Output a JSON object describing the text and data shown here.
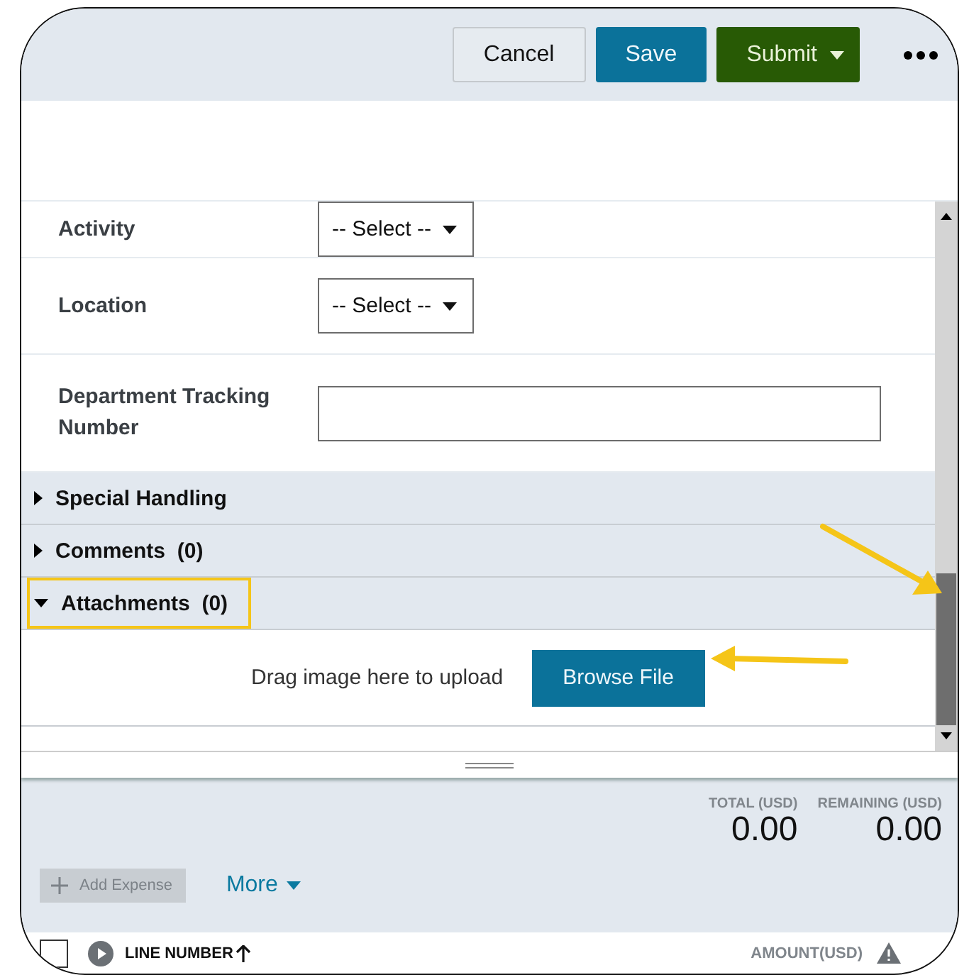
{
  "toolbar": {
    "buttons": [
      {
        "label": "Cancel",
        "kind": "secondary"
      },
      {
        "label": "Save",
        "kind": "primary"
      },
      {
        "label": "Submit",
        "kind": "submit"
      }
    ]
  },
  "form": {
    "fields": [
      {
        "label": "Activity",
        "kind": "select",
        "value": "-- Select --"
      },
      {
        "label": "Location",
        "kind": "select",
        "value": "-- Select --"
      },
      {
        "label": "Department Tracking Number",
        "kind": "text"
      }
    ]
  },
  "sections": [
    {
      "title": "Special Handling",
      "expanded": false,
      "highlighted": false
    },
    {
      "title": "Comments",
      "count": "(0)",
      "expanded": false,
      "highlighted": false
    },
    {
      "title": "Attachments",
      "count": "(0)",
      "expanded": true,
      "highlighted": true
    }
  ],
  "upload": {
    "hint": "Drag image here to upload",
    "button": "Browse File"
  },
  "summary": {
    "totals": [
      {
        "label": "TOTAL (USD)",
        "value": "0.00"
      },
      {
        "label": "REMAINING (USD)",
        "value": "0.00"
      }
    ],
    "add_button": {
      "label": "Add Expense",
      "disabled": true
    },
    "more": {
      "label": "More"
    }
  },
  "table": {
    "select_all": {
      "checked": false
    },
    "columns": [
      {
        "label": "LINE NUMBER",
        "sort_ascending": true
      },
      {
        "label": "AMOUNT(USD)",
        "warning": true
      }
    ]
  }
}
